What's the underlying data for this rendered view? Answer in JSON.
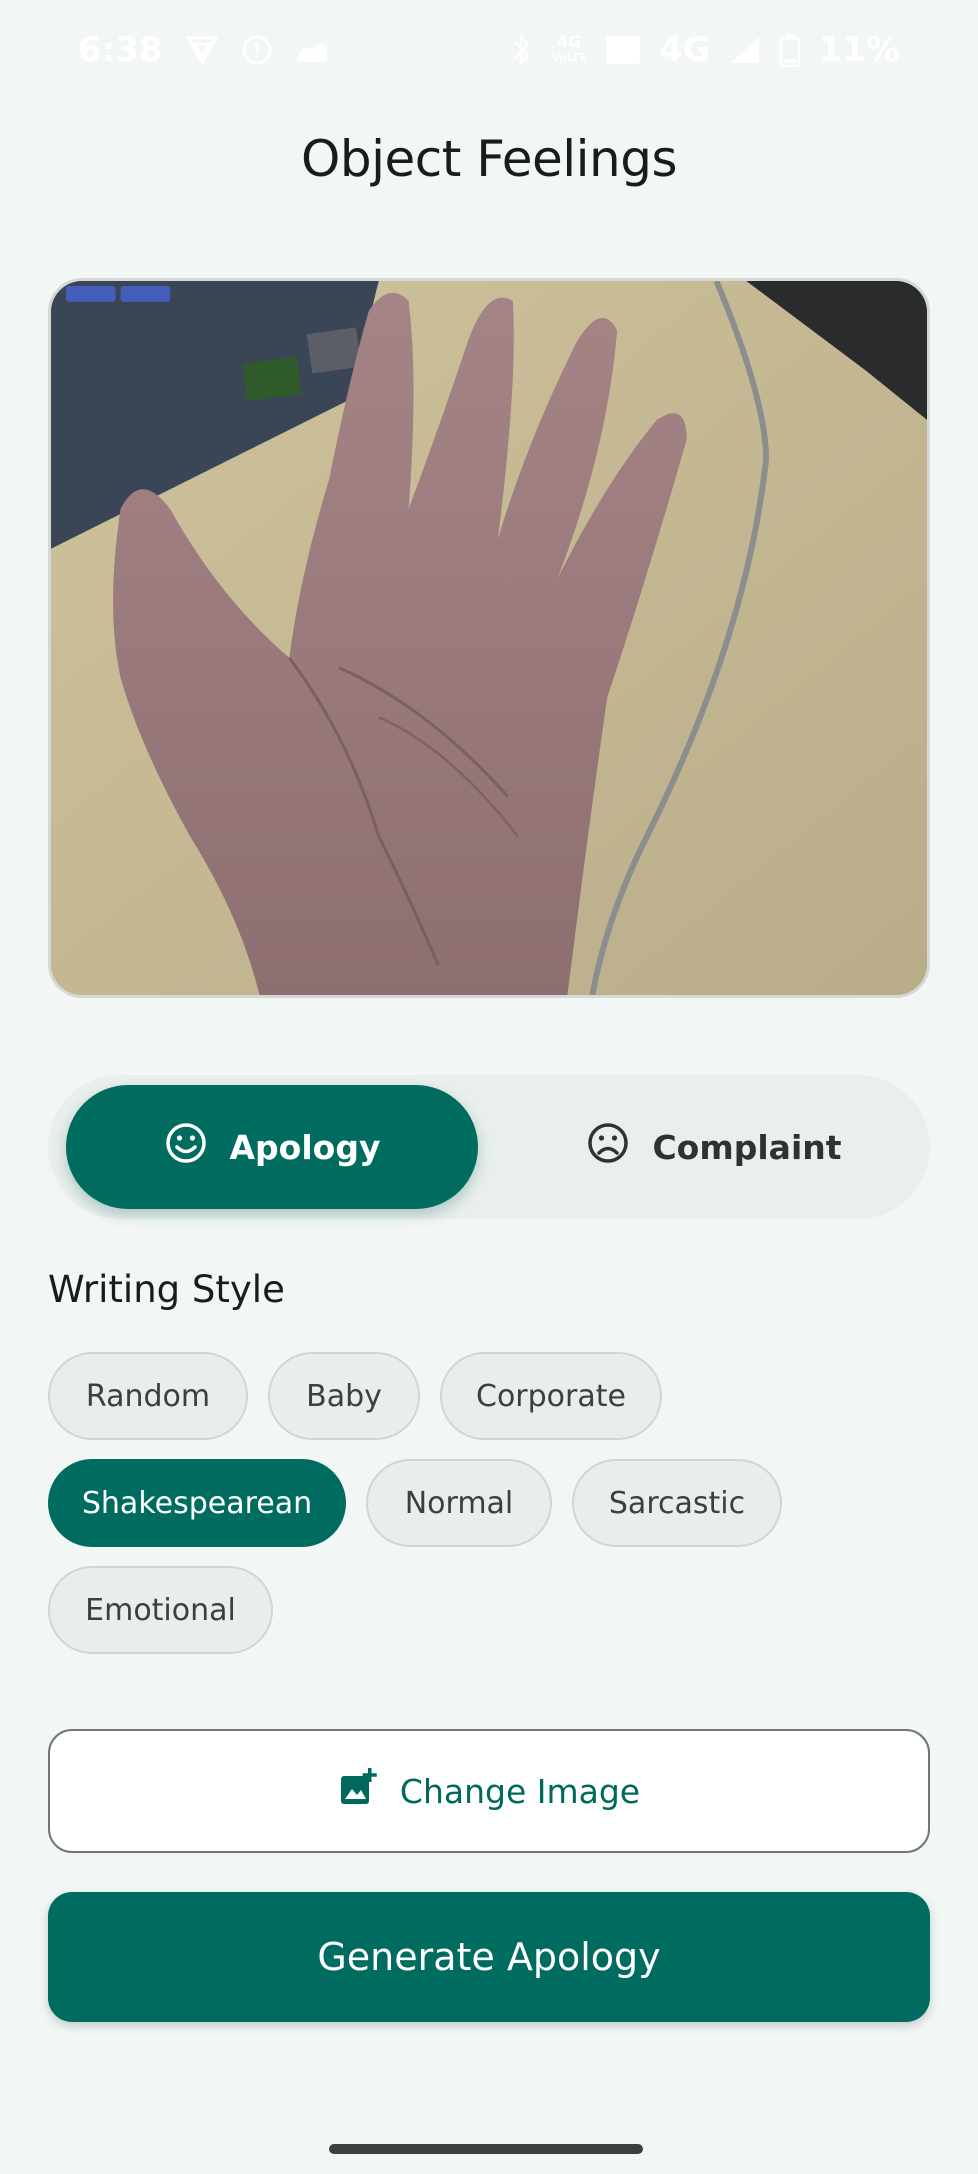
{
  "status_bar": {
    "time": "6:38",
    "network_top": "4G",
    "network_bottom": "VoLTE",
    "network_type": "4G",
    "battery": "11%"
  },
  "app": {
    "title": "Object Feelings"
  },
  "image": {
    "description_icon": "photo-preview"
  },
  "mode_toggle": {
    "apology_label": "Apology",
    "complaint_label": "Complaint",
    "selected": "Apology"
  },
  "writing_style": {
    "label": "Writing Style",
    "chips": [
      "Random",
      "Baby",
      "Corporate",
      "Shakespearean",
      "Normal",
      "Sarcastic",
      "Emotional"
    ],
    "selected": "Shakespearean"
  },
  "actions": {
    "change_image_label": "Change Image",
    "generate_label": "Generate Apology"
  },
  "colors": {
    "primary": "#006c5f",
    "background": "#f2f7f5",
    "chip_bg": "#e9eeec"
  }
}
